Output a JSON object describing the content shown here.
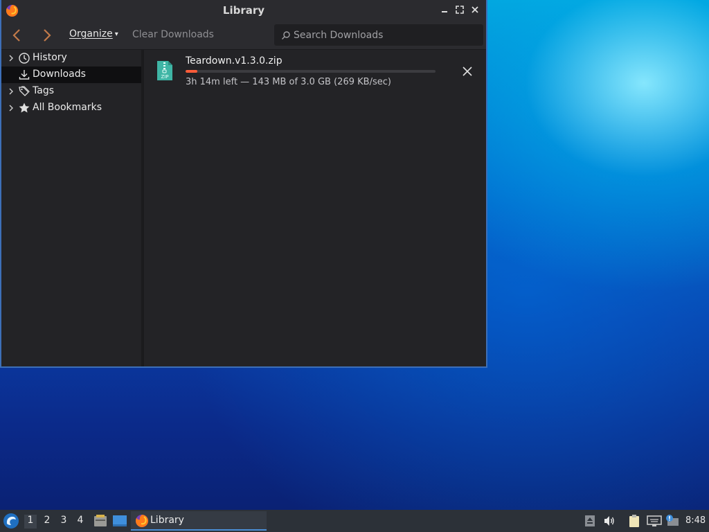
{
  "window": {
    "title": "Library",
    "controls": {
      "minimize": "minimize",
      "maximize": "maximize",
      "close": "close"
    }
  },
  "toolbar": {
    "organize_label": "Organize",
    "clear_label": "Clear Downloads",
    "search_placeholder": "Search Downloads",
    "search_value": ""
  },
  "sidebar": {
    "items": [
      {
        "label": "History",
        "icon": "clock-icon",
        "expandable": true,
        "selected": false
      },
      {
        "label": "Downloads",
        "icon": "download-icon",
        "expandable": false,
        "selected": true
      },
      {
        "label": "Tags",
        "icon": "tags-icon",
        "expandable": true,
        "selected": false
      },
      {
        "label": "All Bookmarks",
        "icon": "star-icon",
        "expandable": true,
        "selected": false
      }
    ]
  },
  "downloads": [
    {
      "filename": "Teardown.v1.3.0.zip",
      "status": "3h 14m left — 143 MB of 3.0 GB (269 KB/sec)",
      "progress_fraction": 0.047,
      "icon": "zip-file-icon"
    }
  ],
  "taskbar": {
    "workspaces": [
      "1",
      "2",
      "3",
      "4"
    ],
    "active_workspace": "1",
    "task_label": "Library",
    "clock": "8:48"
  },
  "colors": {
    "accent": "#4a90d9",
    "progress": "#ff5c39",
    "window_border": "#3d6fb8",
    "background": "#232326"
  }
}
